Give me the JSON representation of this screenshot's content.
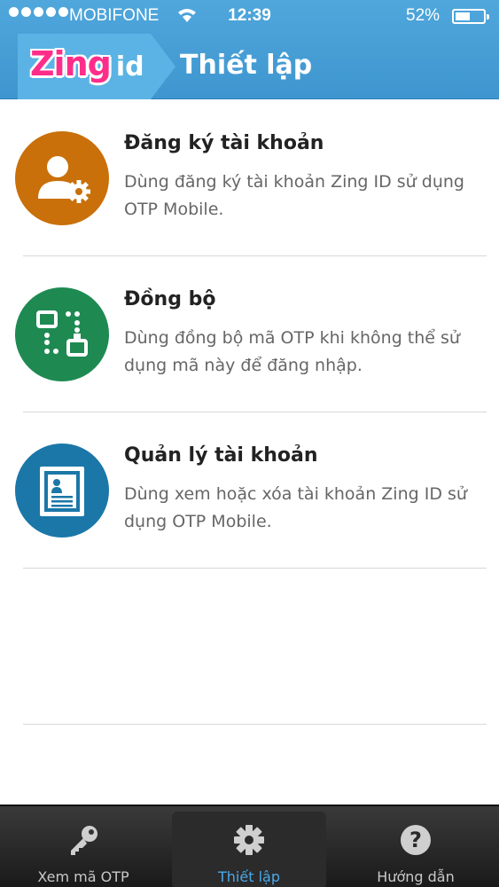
{
  "status_bar": {
    "carrier": "MOBIFONE",
    "time": "12:39",
    "battery_percent": "52%",
    "battery_level": 0.52
  },
  "header": {
    "logo_zing": "Zing",
    "logo_id": "id",
    "title": "Thiết lập"
  },
  "menu": [
    {
      "title": "Đăng ký tài khoản",
      "description": "Dùng đăng ký tài khoản Zing ID sử dụng OTP Mobile.",
      "icon": "user-settings-icon",
      "color": "#c9700a"
    },
    {
      "title": "Đồng bộ",
      "description": "Dùng đồng bộ mã OTP khi không thể sử dụng mã này để đăng nhập.",
      "icon": "sync-icon",
      "color": "#1e8a52"
    },
    {
      "title": "Quản lý tài khoản",
      "description": "Dùng xem hoặc xóa tài khoản Zing ID sử dụng OTP Mobile.",
      "icon": "account-card-icon",
      "color": "#1b77a8"
    }
  ],
  "tabs": [
    {
      "label": "Xem mã OTP",
      "icon": "key-icon",
      "active": false
    },
    {
      "label": "Thiết lập",
      "icon": "gear-icon",
      "active": true
    },
    {
      "label": "Hướng dẫn",
      "icon": "help-icon",
      "active": false
    }
  ],
  "colors": {
    "header": "#4fa7dc",
    "active_tab": "#4aa9ea"
  }
}
